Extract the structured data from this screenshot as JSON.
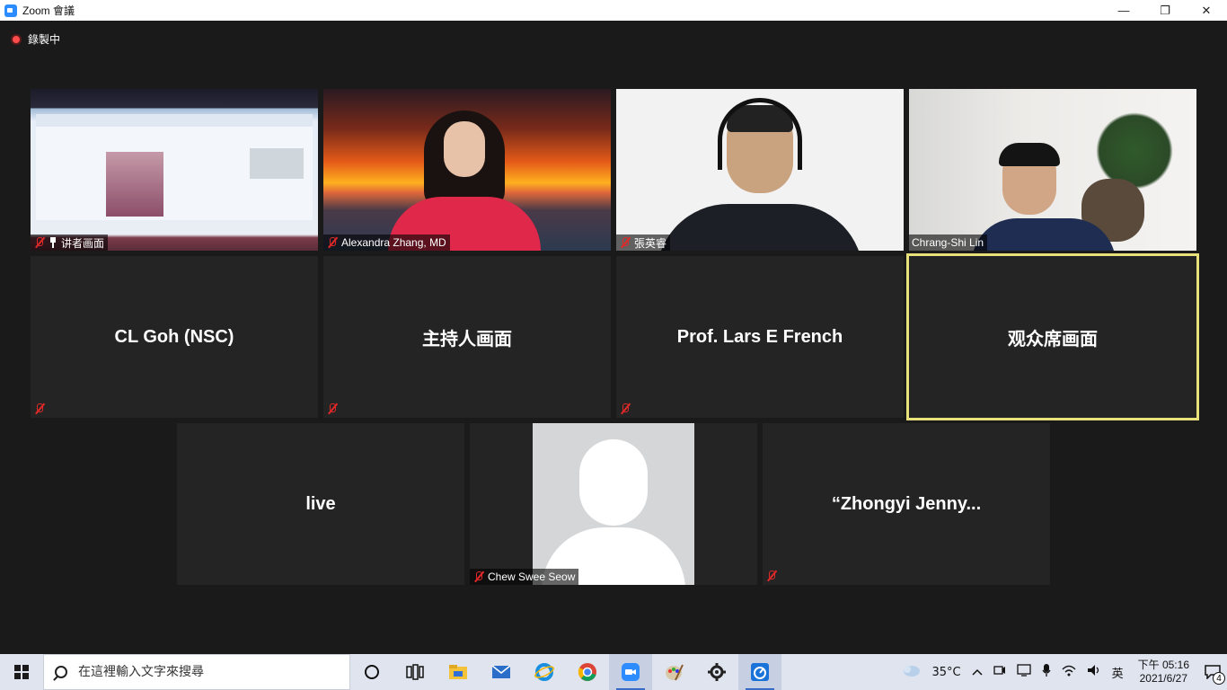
{
  "window": {
    "title": "Zoom 會議",
    "minimize": "—",
    "maximize": "❐",
    "close": "✕"
  },
  "recording": {
    "label": "錄製中"
  },
  "tiles": [
    {
      "name": "讲者画面",
      "type": "video",
      "muted": true,
      "pinned": true
    },
    {
      "name": "Alexandra Zhang, MD",
      "type": "video",
      "muted": true
    },
    {
      "name": "張英睿",
      "type": "video",
      "muted": true
    },
    {
      "name": "Chrang-Shi Lin",
      "type": "video",
      "muted": false
    },
    {
      "name": "CL Goh (NSC)",
      "type": "name-only",
      "muted": true
    },
    {
      "name": "主持人画面",
      "type": "name-only",
      "muted": true
    },
    {
      "name": "Prof. Lars E French",
      "type": "name-only",
      "muted": true
    },
    {
      "name": "观众席画面",
      "type": "name-only",
      "muted": false,
      "active_speaker": true
    },
    {
      "name": "live",
      "type": "name-only",
      "muted": false
    },
    {
      "name": "Chew Swee Seow",
      "type": "avatar",
      "muted": true
    },
    {
      "name": "“Zhongyi Jenny...",
      "type": "name-only",
      "muted": true
    }
  ],
  "taskbar": {
    "search_placeholder": "在這裡輸入文字來搜尋",
    "apps": [
      "cortana-icon",
      "task-view-icon",
      "file-explorer-icon",
      "mail-icon",
      "edge-icon",
      "chrome-icon",
      "zoom-icon",
      "paint-icon",
      "settings-icon",
      "app-icon"
    ],
    "temperature": "35°C",
    "ime": "英",
    "clock_time": "下午 05:16",
    "clock_date": "2021/6/27",
    "notification_count": "4"
  },
  "colors": {
    "active_speaker_border": "#e8e07a",
    "muted_icon": "#e02828",
    "background": "#1a1a1a"
  }
}
